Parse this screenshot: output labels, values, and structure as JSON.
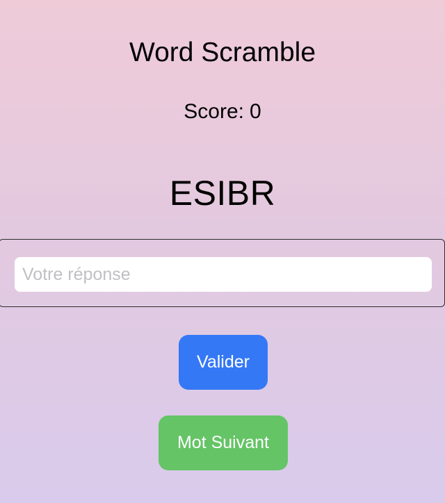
{
  "app": {
    "title": "Word Scramble"
  },
  "score": {
    "label": "Score:",
    "value": "0"
  },
  "puzzle": {
    "scrambled_word": "ESIBR"
  },
  "answer": {
    "value": "",
    "placeholder": "Votre réponse"
  },
  "actions": {
    "validate_label": "Valider",
    "next_label": "Mot Suivant"
  },
  "colors": {
    "validate_button": "#3478f6",
    "next_button": "#65c466",
    "background_top": "#efcbd8",
    "background_bottom": "#d9cbec",
    "placeholder_text": "#c0c0c4"
  }
}
